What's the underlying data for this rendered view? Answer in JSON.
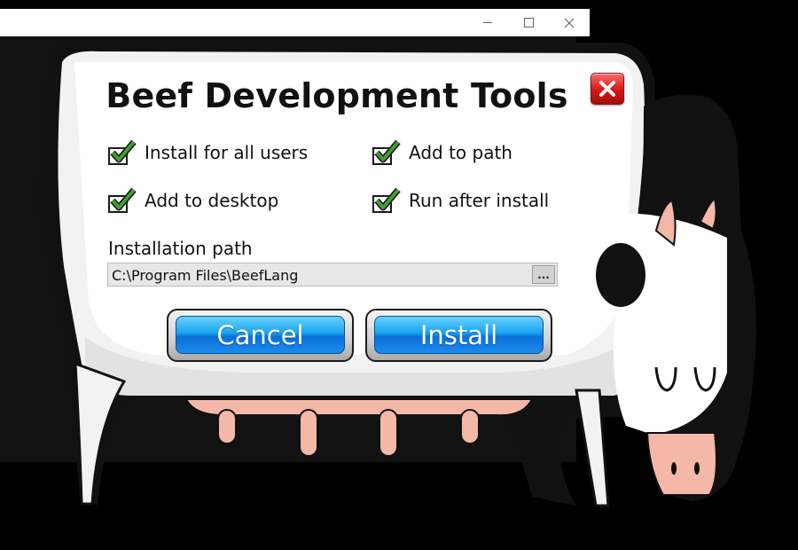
{
  "window": {
    "minimize_icon": "minimize-icon",
    "maximize_icon": "maximize-icon",
    "close_icon": "close-icon"
  },
  "dialog": {
    "title": "Beef Development Tools",
    "close_icon": "red-x-close-icon",
    "options": [
      {
        "label": "Install for all users",
        "checked": true
      },
      {
        "label": "Add to path",
        "checked": true
      },
      {
        "label": "Add to desktop",
        "checked": true
      },
      {
        "label": "Run after install",
        "checked": true
      }
    ],
    "path_label": "Installation path",
    "path_value": "C:\\Program Files\\BeefLang",
    "browse_label": "...",
    "cancel_label": "Cancel",
    "install_label": "Install"
  },
  "colors": {
    "button_blue": "#1aa2ef",
    "close_red": "#d31717",
    "check_green": "#3fa12f",
    "udder_pink": "#f5b8a8"
  }
}
